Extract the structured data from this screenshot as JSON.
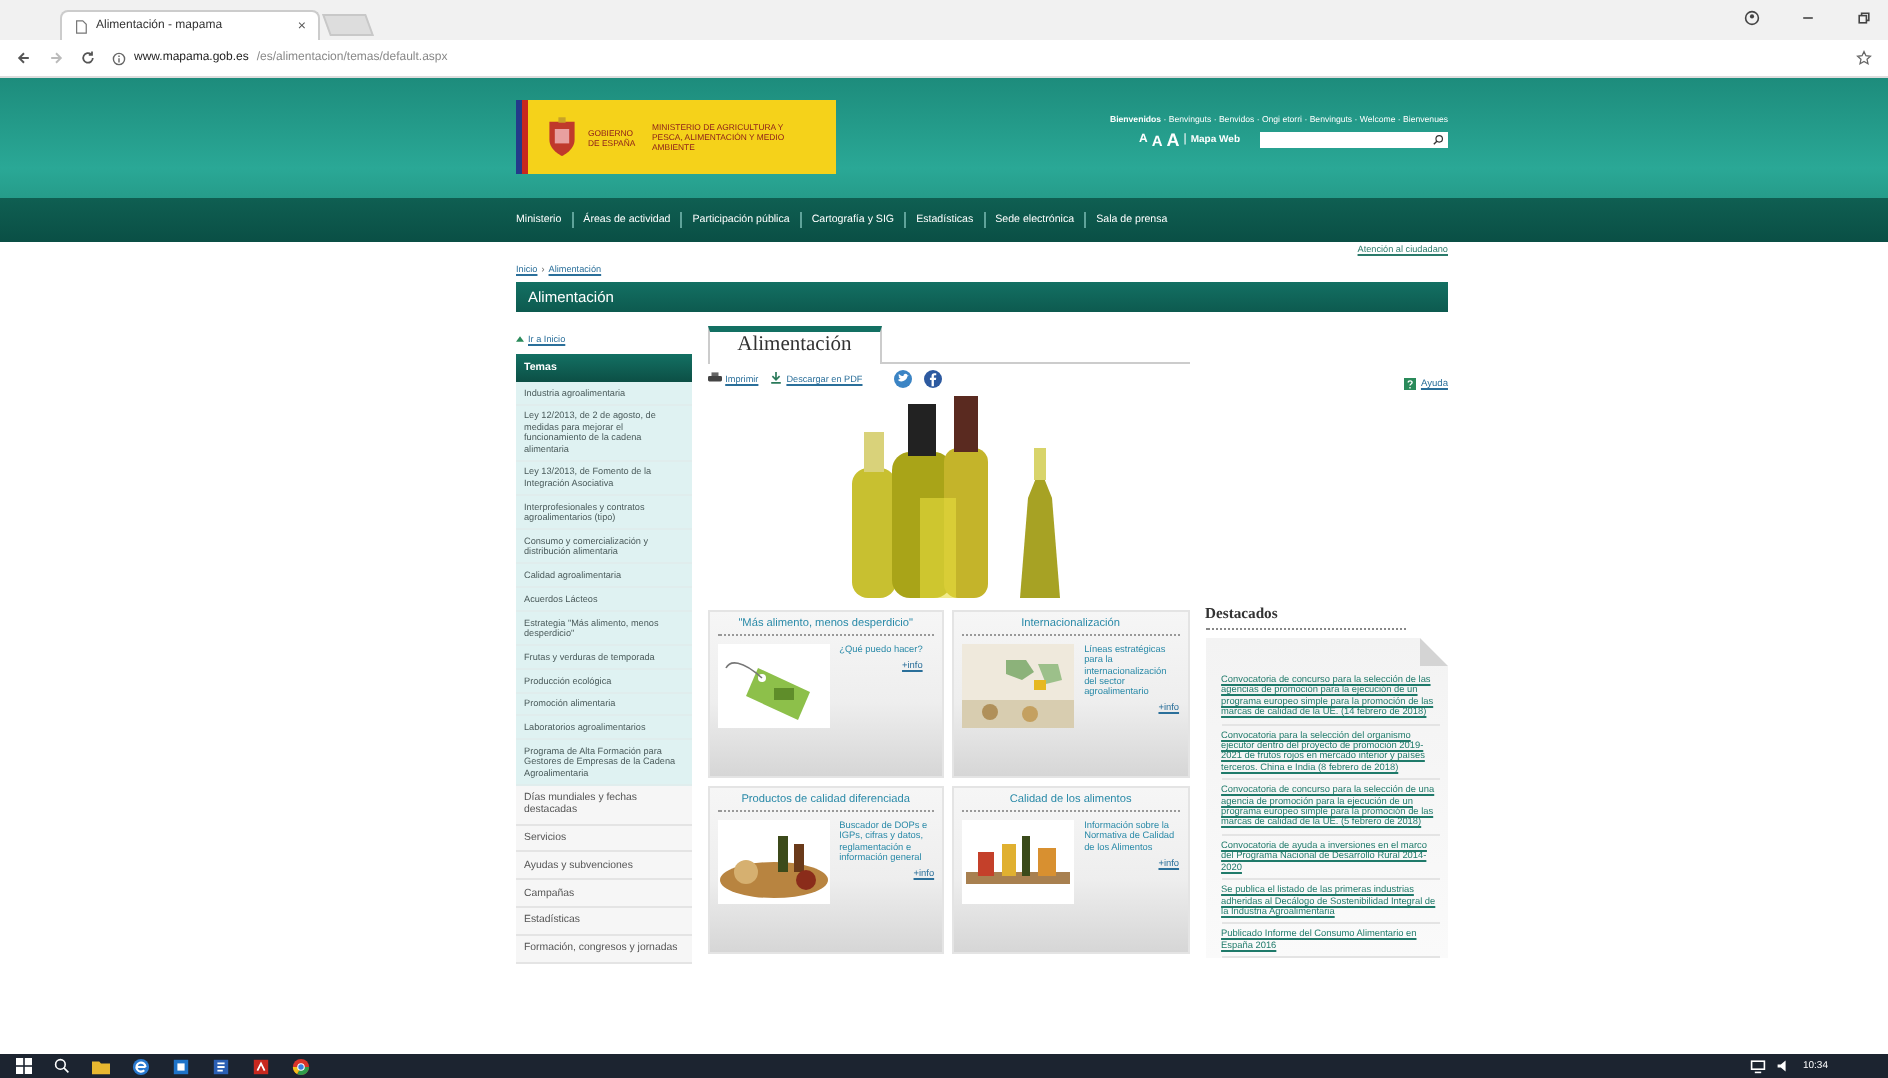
{
  "browser": {
    "tab_title": "Alimentación - mapama",
    "tab_close": "×",
    "url_host": "www.mapama.gob.es",
    "url_path": "/es/alimentacion/temas/default.aspx"
  },
  "header": {
    "logo_government": "GOBIERNO DE ESPAÑA",
    "logo_ministry": "MINISTERIO DE AGRICULTURA Y PESCA, ALIMENTACIÓN Y MEDIO AMBIENTE",
    "welcome": "**Bienvenidos** · Benvinguts · Benvidos · Ongi etorri · Benvinguts · Welcome · Bienvenues",
    "font_sizes": [
      "A",
      "A",
      "A"
    ],
    "links_separator": "|",
    "site_map": "Mapa Web",
    "nav": [
      "Ministerio",
      "Áreas de actividad",
      "Participación pública",
      "Cartografía y SIG",
      "Estadísticas",
      "Sede electrónica",
      "Sala de prensa"
    ]
  },
  "citizen_link": "Atención al ciudadano",
  "breadcrumb": {
    "items": [
      "Inicio",
      "Alimentación"
    ],
    "separator": "›"
  },
  "section_title": "Alimentación",
  "sidebar": {
    "home_link": "Ir a Inicio",
    "heading": "Temas",
    "topics": [
      "Industria agroalimentaria",
      "Ley 12/2013, de 2 de agosto, de medidas para mejorar el funcionamiento de la cadena alimentaria",
      "Ley 13/2013, de Fomento de la Integración Asociativa",
      "Interprofesionales y contratos agroalimentarios (tipo)",
      "Consumo y comercialización y distribución alimentaria",
      "Calidad agroalimentaria",
      "Acuerdos Lácteos",
      "Estrategia \"Más alimento, menos desperdicio\"",
      "Frutas y verduras de temporada",
      "Producción ecológica",
      "Promoción alimentaria",
      "Laboratorios agroalimentarios",
      "Programa de Alta Formación para Gestores de Empresas de la Cadena Agroalimentaria"
    ],
    "more_items": [
      "Días mundiales y fechas destacadas",
      "Servicios",
      "Ayudas y subvenciones",
      "Campañas",
      "Estadísticas",
      "Formación, congresos y jornadas"
    ]
  },
  "main": {
    "tab": "Alimentación",
    "tools": [
      {
        "label": "Imprimir",
        "kind": "print"
      },
      {
        "label": "Descargar en PDF",
        "kind": "download"
      }
    ],
    "help": "Ayuda",
    "cards": [
      {
        "title": "\"Más alimento, menos desperdicio\"",
        "text": "¿Qué puedo hacer?",
        "link": "+info",
        "kind": "tag"
      },
      {
        "title": "Internacionalización",
        "text": "Líneas estratégicas para la internacionalización del sector agroalimentario",
        "link": "+info",
        "kind": "map"
      },
      {
        "title": "Productos de calidad diferenciada",
        "text": "Buscador de DOPs e IGPs, cifras y datos, reglamentación e información general",
        "link": "+info",
        "kind": "food"
      },
      {
        "title": "Calidad de los alimentos",
        "text": "Información sobre la Normativa de Calidad de los Alimentos",
        "link": "+info",
        "kind": "jars"
      }
    ]
  },
  "featured": {
    "title": "Destacados",
    "items": [
      "Convocatoria de concurso para la selección de las agencias de promoción para la ejecución de un programa europeo simple para la promoción de las marcas de calidad de la UE. (14 febrero de 2018)",
      "Convocatoria para la selección del organismo ejecutor dentro del proyecto de promoción 2019-2021 de frutos rojos en mercado interior y países terceros. China e India (8 febrero de 2018)",
      "Convocatoria de concurso para la selección de una agencia de promoción para la ejecución de un programa europeo simple para la promoción de las marcas de calidad de la UE. (5 febrero de 2018)",
      "Convocatoria de ayuda a inversiones en el marco del Programa Nacional de Desarrollo Rural 2014-2020",
      "Se publica el listado de las primeras industrias adheridas al Decálogo de Sostenibilidad Integral de la Industria Agroalimentaria",
      "Publicado Informe del Consumo Alimentario en España 2016"
    ]
  },
  "taskbar": {
    "time": "10:34"
  }
}
